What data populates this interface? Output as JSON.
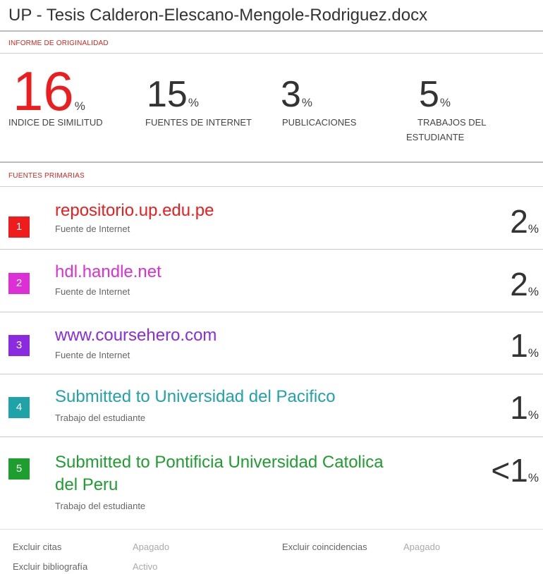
{
  "document": {
    "title": "UP - Tesis Calderon-Elescano-Mengole-Rodriguez.docx"
  },
  "report": {
    "section_label": "INFORME DE ORIGINALIDAD",
    "stats": [
      {
        "value": "16",
        "unit": "%",
        "caption": "INDICE DE SIMILITUD"
      },
      {
        "value": "15",
        "unit": "%",
        "caption": "FUENTES DE INTERNET"
      },
      {
        "value": "3",
        "unit": "%",
        "caption": "PUBLICACIONES"
      },
      {
        "value": "5",
        "unit": "%",
        "caption_line1": "TRABAJOS DEL",
        "caption_line2": "ESTUDIANTE"
      }
    ]
  },
  "sources": {
    "section_label": "FUENTES PRIMARIAS",
    "items": [
      {
        "rank": "1",
        "name": "repositorio.up.edu.pe",
        "type": "Fuente de Internet",
        "value": "2",
        "unit": "%",
        "color": "#ee1c1c"
      },
      {
        "rank": "2",
        "name": "hdl.handle.net",
        "type": "Fuente de Internet",
        "value": "2",
        "unit": "%",
        "color": "#dd2fd6"
      },
      {
        "rank": "3",
        "name": "www.coursehero.com",
        "type": "Fuente de Internet",
        "value": "1",
        "unit": "%",
        "color": "#8a2be2"
      },
      {
        "rank": "4",
        "name": "Submitted to Universidad del Pacifico",
        "type": "Trabajo del estudiante",
        "value": "1",
        "unit": "%",
        "color": "#1fa3a8"
      },
      {
        "rank": "5",
        "name_line1": "Submitted to Pontificia Universidad Catolica",
        "name_line2": "del Peru",
        "type": "Trabajo del estudiante",
        "value": "<1",
        "unit": "%",
        "color": "#1e9e2e"
      }
    ]
  },
  "footer": {
    "exclude_quotes_label": "Excluir citas",
    "exclude_quotes_value": "Apagado",
    "exclude_bibliography_label": "Excluir bibliografía",
    "exclude_bibliography_value": "Activo",
    "exclude_matches_label": "Excluir coincidencias",
    "exclude_matches_value": "Apagado"
  }
}
